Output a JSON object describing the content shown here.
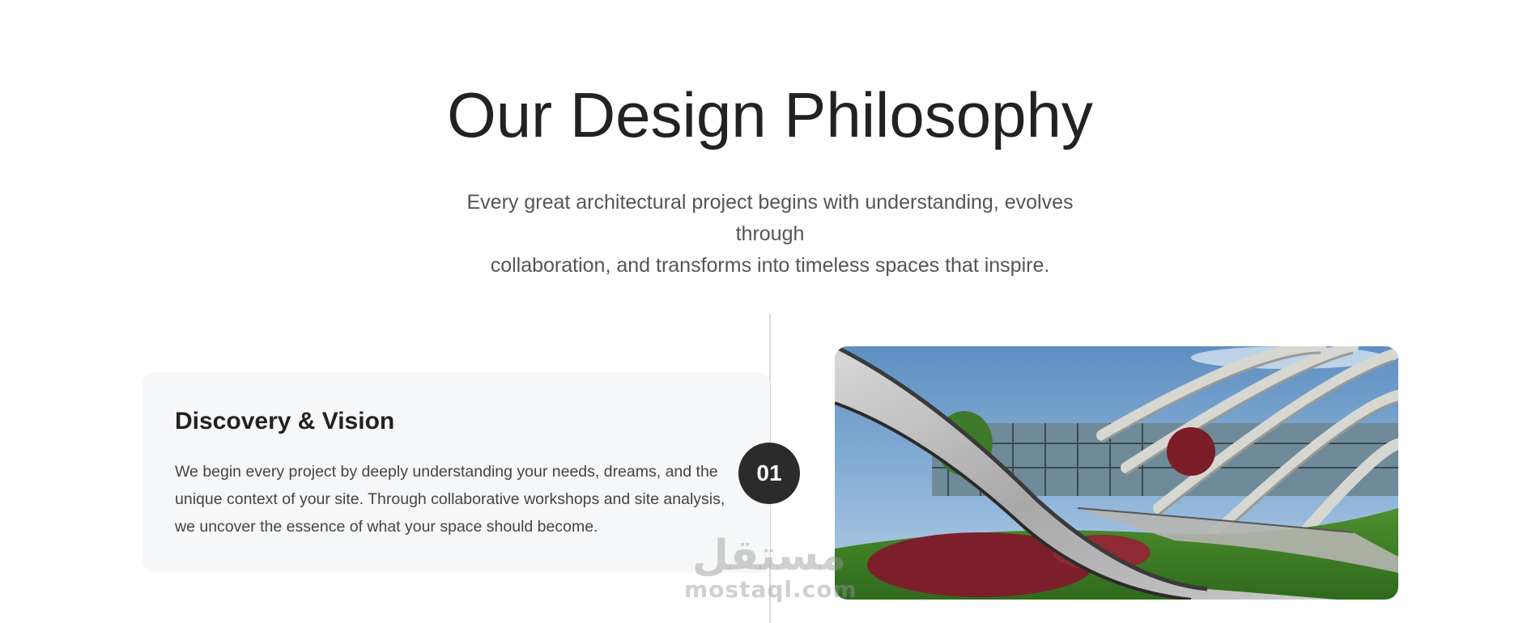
{
  "header": {
    "title": "Our Design Philosophy",
    "subtitle_line1": "Every great architectural project begins with understanding, evolves through",
    "subtitle_line2": "collaboration, and transforms into timeless spaces that inspire."
  },
  "steps": [
    {
      "number": "01",
      "title": "Discovery & Vision",
      "description": "We begin every project by deeply understanding your needs, dreams, and the unique context of your site. Through collaborative workshops and site analysis, we uncover the essence of what your space should become.",
      "image": "curved-architecture-photo"
    }
  ],
  "watermark": {
    "arabic": "مستقل",
    "latin": "mostaql.com"
  },
  "colors": {
    "heading": "#222222",
    "body": "#555555",
    "card_bg": "#f6f7f8",
    "badge_bg": "#2b2b2b",
    "timeline": "#d9d9d9"
  }
}
